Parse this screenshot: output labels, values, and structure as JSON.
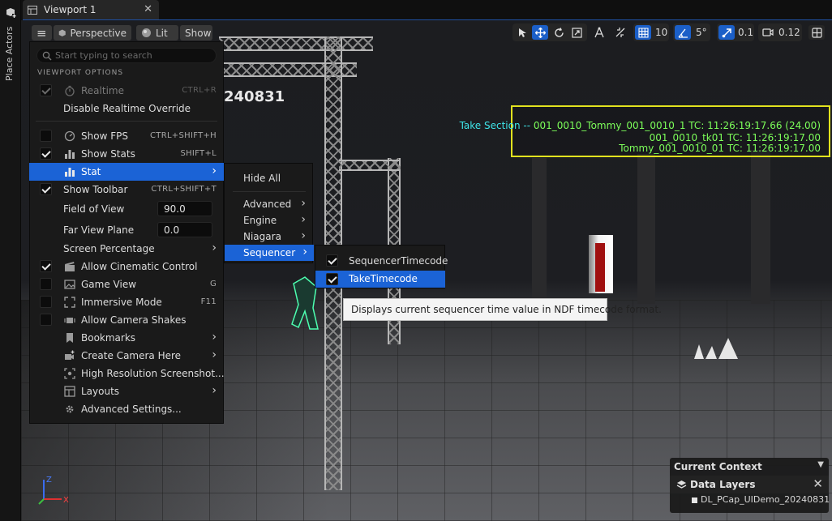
{
  "sidebar": {
    "place_actors_label": "Place Actors"
  },
  "tab": {
    "title": "Viewport 1",
    "close_glyph": "✕"
  },
  "toolbar": {
    "menu_glyph": "≡",
    "perspective": "Perspective",
    "lit": "Lit",
    "show": "Show",
    "grid_snap": "10",
    "rotation_snap": "5°",
    "scale_snap": "0.1",
    "camera_speed": "0.12"
  },
  "scene": {
    "label_fragment": "240831"
  },
  "overlay": {
    "line1_prefix": "Take Section -- ",
    "line1_value": "001_0010_Tommy_001_0010_1 TC: 11:26:19:17.66 (24.00)",
    "line2": "001_0010_tk01 TC: 11:26:19:17.00",
    "line3": "Tommy_001_0010_01 TC: 11:26:19:17.00"
  },
  "menu": {
    "search_placeholder": "Start typing to search",
    "section_header": "VIEWPORT OPTIONS",
    "items": {
      "realtime": {
        "label": "Realtime",
        "shortcut": "CTRL+R"
      },
      "disable_realtime": {
        "label": "Disable Realtime Override"
      },
      "show_fps": {
        "label": "Show FPS",
        "shortcut": "CTRL+SHIFT+H"
      },
      "show_stats": {
        "label": "Show Stats",
        "shortcut": "SHIFT+L"
      },
      "stat": {
        "label": "Stat"
      },
      "show_toolbar": {
        "label": "Show Toolbar",
        "shortcut": "CTRL+SHIFT+T"
      },
      "fov": {
        "label": "Field of View",
        "value": "90.0"
      },
      "far_plane": {
        "label": "Far View Plane",
        "value": "0.0"
      },
      "screen_pct": {
        "label": "Screen Percentage"
      },
      "cinematic": {
        "label": "Allow Cinematic Control"
      },
      "game_view": {
        "label": "Game View",
        "shortcut": "G"
      },
      "immersive": {
        "label": "Immersive Mode",
        "shortcut": "F11"
      },
      "shakes": {
        "label": "Allow Camera Shakes"
      },
      "bookmarks": {
        "label": "Bookmarks"
      },
      "create_camera": {
        "label": "Create Camera Here"
      },
      "hires": {
        "label": "High Resolution Screenshot..."
      },
      "layouts": {
        "label": "Layouts"
      },
      "advanced": {
        "label": "Advanced Settings..."
      }
    }
  },
  "stat_menu": {
    "hide_all": "Hide All",
    "advanced": "Advanced",
    "engine": "Engine",
    "niagara": "Niagara",
    "sequencer": "Sequencer"
  },
  "sequencer_menu": {
    "sequencer_timecode": "SequencerTimecode",
    "take_timecode": "TakeTimecode"
  },
  "tooltip": {
    "text": "Displays current sequencer time value in NDF timecode format."
  },
  "context": {
    "title": "Current Context",
    "data_layers": "Data Layers",
    "layer_name": "DL_PCap_UIDemo_20240831"
  },
  "axis": {
    "z": "Z",
    "x": "X"
  },
  "colors": {
    "accent": "#1b63d6",
    "overlay_border": "#e2e21e",
    "overlay_cyan": "#3ee4e8",
    "overlay_green": "#7dff5a"
  }
}
